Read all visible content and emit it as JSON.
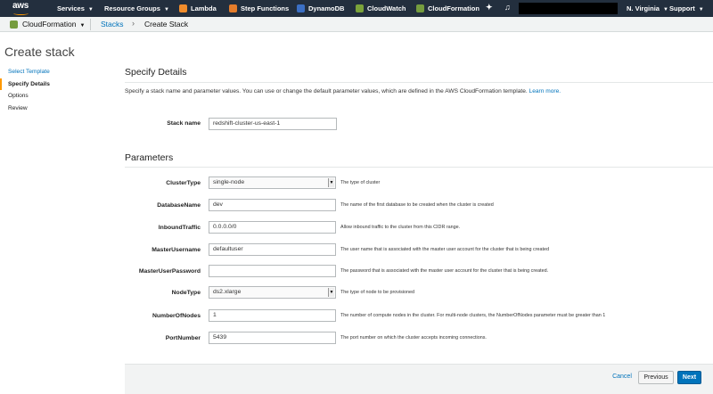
{
  "topnav": {
    "logo": "aws",
    "items": [
      {
        "label": "Services",
        "icon": "none",
        "caret": true
      },
      {
        "label": "Resource Groups",
        "icon": "none",
        "caret": true
      },
      {
        "label": "Lambda",
        "icon": "lambda-icon"
      },
      {
        "label": "Step Functions",
        "icon": "step-functions-icon"
      },
      {
        "label": "DynamoDB",
        "icon": "dynamodb-icon"
      },
      {
        "label": "CloudWatch",
        "icon": "cloudwatch-icon"
      },
      {
        "label": "CloudFormation",
        "icon": "cloudformation-icon"
      }
    ],
    "region": "N. Virginia",
    "support": "Support",
    "bg_color": "#232f3e",
    "accent": "#ff9900"
  },
  "breadcrumb": {
    "service": "CloudFormation",
    "stacks": "Stacks",
    "current": "Create Stack"
  },
  "page_title": "Create stack",
  "sidebar": {
    "items": [
      {
        "label": "Select Template"
      },
      {
        "label": "Specify Details"
      },
      {
        "label": "Options"
      },
      {
        "label": "Review"
      }
    ]
  },
  "details": {
    "title": "Specify Details",
    "description": "Specify a stack name and parameter values. You can use or change the default parameter values, which are defined in the AWS CloudFormation template.",
    "learn_more": "Learn more.",
    "stack_name_label": "Stack name",
    "stack_name_value": "redshift-cluster-us-east-1"
  },
  "parameters": {
    "title": "Parameters",
    "rows": [
      {
        "label": "ClusterType",
        "value": "single-node",
        "help": "The type of cluster"
      },
      {
        "label": "DatabaseName",
        "value": "dev",
        "help": "The name of the first database to be created when the cluster is created"
      },
      {
        "label": "InboundTraffic",
        "value": "0.0.0.0/0",
        "help": "Allow inbound traffic to the cluster from this CIDR range."
      },
      {
        "label": "MasterUsername",
        "value": "defaultuser",
        "help": "The user name that is associated with the master user account for the cluster that is being created"
      },
      {
        "label": "MasterUserPassword",
        "value": "",
        "help": "The password that is associated with the master user account for the cluster that is being created."
      },
      {
        "label": "NodeType",
        "value": "ds2.xlarge",
        "help": "The type of node to be provisioned"
      },
      {
        "label": "NumberOfNodes",
        "value": "1",
        "help": "The number of compute nodes in the cluster. For multi-node clusters, the NumberOfNodes parameter must be greater than 1"
      },
      {
        "label": "PortNumber",
        "value": "5439",
        "help": "The port number on which the cluster accepts incoming connections."
      }
    ]
  },
  "footer": {
    "cancel": "Cancel",
    "previous": "Previous",
    "next": "Next"
  },
  "colors": {
    "link": "#0073bb",
    "primary_button": "#0073bb"
  }
}
